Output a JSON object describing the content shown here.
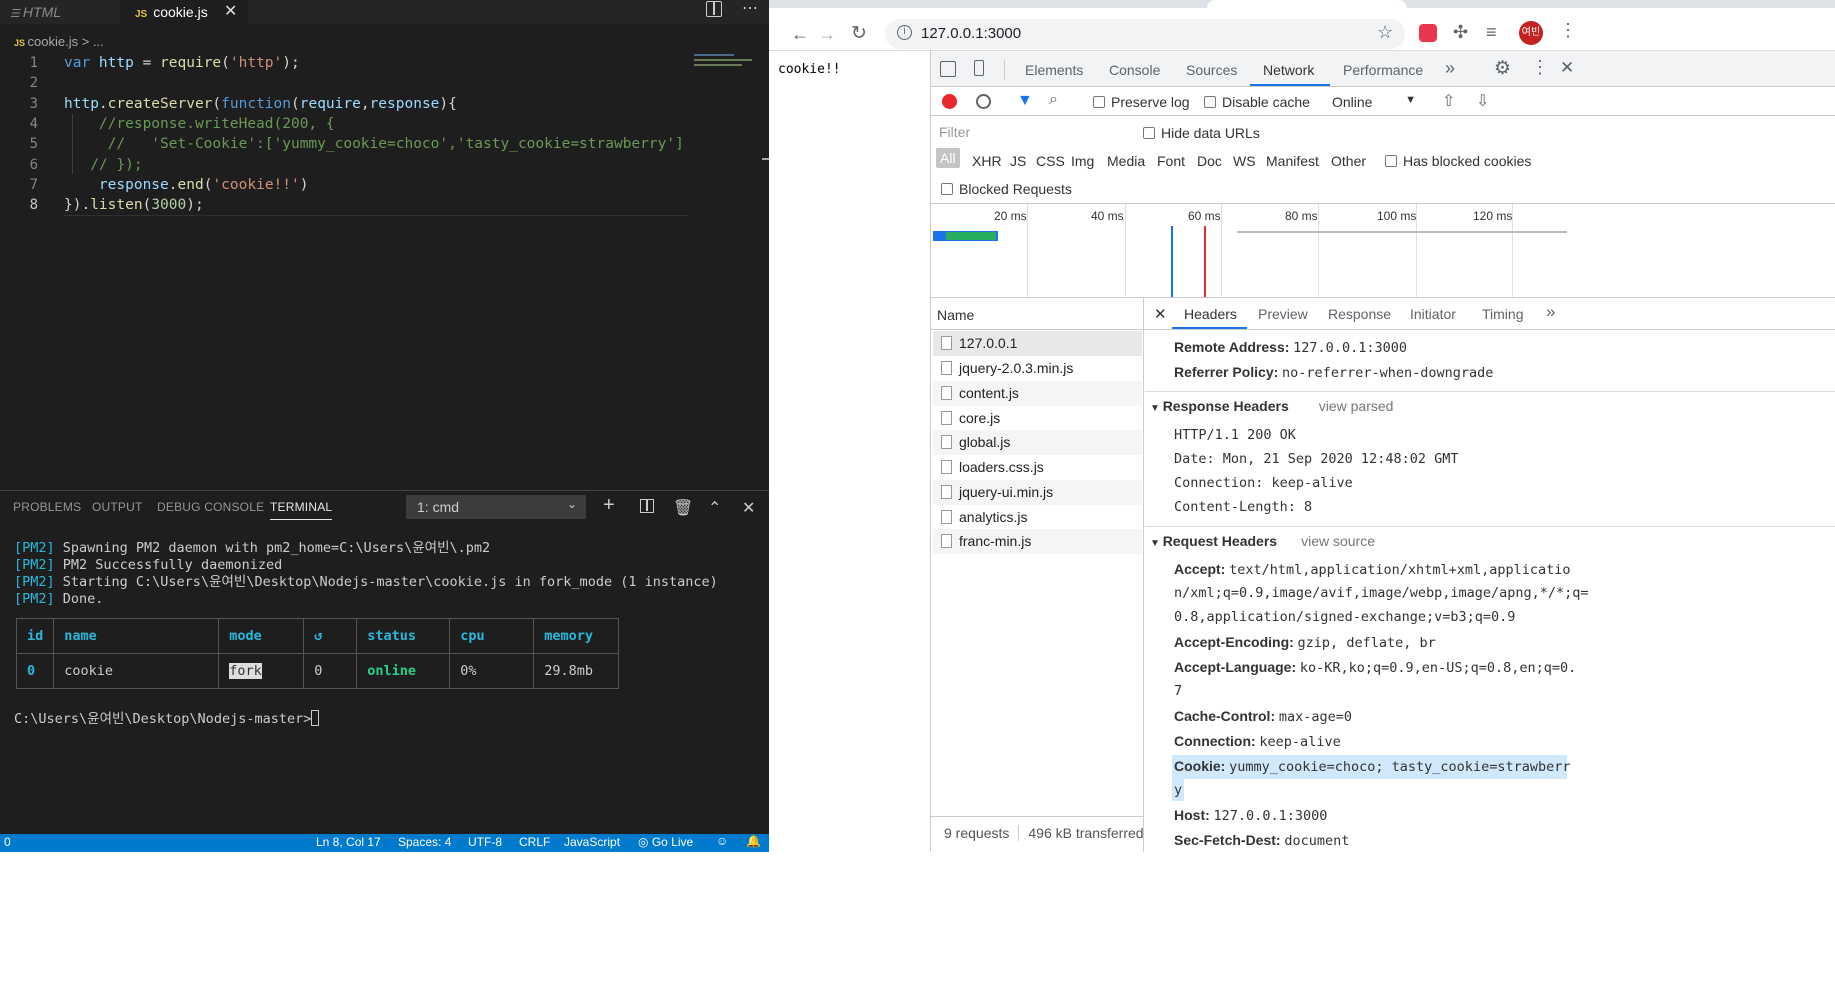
{
  "vscode": {
    "tabs": {
      "html_label": "HTML",
      "active_label": "cookie.js",
      "js_badge": "JS"
    },
    "breadcrumb": "cookie.js > ...",
    "line_numbers": [
      "1",
      "2",
      "3",
      "4",
      "5",
      "6",
      "7",
      "8"
    ],
    "code": {
      "l1a": "var ",
      "l1b": "http",
      "l1c": " = ",
      "l1d": "require",
      "l1e": "(",
      "l1f": "'http'",
      "l1g": ");",
      "l3a": "http",
      "l3b": ".",
      "l3c": "createServer",
      "l3d": "(",
      "l3e": "function",
      "l3f": "(",
      "l3g": "require",
      "l3h": ",",
      "l3i": "response",
      "l3j": "){",
      "l4": "    //response.writeHead(200, {",
      "l5": "     //   'Set-Cookie':['yummy_cookie=choco','tasty_cookie=strawberry']",
      "l6": "   // });",
      "l7a": "    response",
      "l7b": ".",
      "l7c": "end",
      "l7d": "(",
      "l7e": "'cookie!!'",
      "l7f": ")",
      "l8a": "}).",
      "l8b": "listen",
      "l8c": "(",
      "l8d": "3000",
      "l8e": ");"
    },
    "panel": {
      "tabs": [
        "PROBLEMS",
        "OUTPUT",
        "DEBUG CONSOLE",
        "TERMINAL"
      ],
      "terminal_select": "1: cmd"
    },
    "terminal": {
      "prefix": "[PM2]",
      "lines": [
        " Spawning PM2 daemon with pm2_home=C:\\Users\\윤여빈\\.pm2",
        " PM2 Successfully daemonized",
        " Starting C:\\Users\\윤여빈\\Desktop\\Nodejs-master\\cookie.js in fork_mode (1 instance)",
        " Done."
      ],
      "table_headers": [
        "id",
        "name",
        "mode",
        "↺",
        "status",
        "cpu",
        "memory"
      ],
      "table_row": [
        "0",
        "cookie",
        "fork",
        "0",
        "online",
        "0%",
        "29.8mb"
      ],
      "prompt": "C:\\Users\\윤여빈\\Desktop\\Nodejs-master>"
    },
    "statusbar": {
      "left": "0",
      "position": "Ln 8, Col 17",
      "spaces": "Spaces: 4",
      "encoding": "UTF-8",
      "eol": "CRLF",
      "language": "JavaScript",
      "golive": "Go Live"
    }
  },
  "chrome": {
    "url": "127.0.0.1:3000",
    "page_text": "cookie!!",
    "avatar": "여빈",
    "devtools": {
      "tabs": [
        "Elements",
        "Console",
        "Sources",
        "Network",
        "Performance"
      ],
      "active_tab": "Network",
      "preserve_log": "Preserve log",
      "disable_cache": "Disable cache",
      "throttle": "Online",
      "filter_placeholder": "Filter",
      "hide_data_urls": "Hide data URLs",
      "type_filters": [
        "All",
        "XHR",
        "JS",
        "CSS",
        "Img",
        "Media",
        "Font",
        "Doc",
        "WS",
        "Manifest",
        "Other"
      ],
      "has_blocked": "Has blocked cookies",
      "blocked_requests": "Blocked Requests",
      "timeline_ticks": [
        "20 ms",
        "40 ms",
        "60 ms",
        "80 ms",
        "100 ms",
        "120 ms"
      ],
      "name_header": "Name",
      "requests": [
        "127.0.0.1",
        "jquery-2.0.3.min.js",
        "content.js",
        "core.js",
        "global.js",
        "loaders.css.js",
        "jquery-ui.min.js",
        "analytics.js",
        "franc-min.js"
      ],
      "summary_requests": "9 requests",
      "summary_transferred": "496 kB transferred",
      "detail_tabs": [
        "Headers",
        "Preview",
        "Response",
        "Initiator",
        "Timing"
      ],
      "general": [
        {
          "k": "Remote Address:",
          "v": "127.0.0.1:3000"
        },
        {
          "k": "Referrer Policy:",
          "v": "no-referrer-when-downgrade"
        }
      ],
      "response_title": "Response Headers",
      "response_link": "view parsed",
      "response_lines": [
        "HTTP/1.1 200 OK",
        "Date: Mon, 21 Sep 2020 12:48:02 GMT",
        "Connection: keep-alive",
        "Content-Length: 8"
      ],
      "request_title": "Request Headers",
      "request_link": "view source",
      "accept_k": "Accept:",
      "accept_v1": "text/html,application/xhtml+xml,applicatio",
      "accept_v2": "n/xml;q=0.9,image/avif,image/webp,image/apng,*/*;q=",
      "accept_v3": "0.8,application/signed-exchange;v=b3;q=0.9",
      "enc_k": "Accept-Encoding:",
      "enc_v": "gzip, deflate, br",
      "lang_k": "Accept-Language:",
      "lang_v1": "ko-KR,ko;q=0.9,en-US;q=0.8,en;q=0.",
      "lang_v2": "7",
      "cache_k": "Cache-Control:",
      "cache_v": "max-age=0",
      "conn_k": "Connection:",
      "conn_v": "keep-alive",
      "cookie_k": "Cookie:",
      "cookie_v1": "yummy_cookie=choco; tasty_cookie=strawberr",
      "cookie_v2": "y",
      "host_k": "Host:",
      "host_v": "127.0.0.1:3000",
      "sfd_k": "Sec-Fetch-Dest:",
      "sfd_v": "document"
    }
  }
}
